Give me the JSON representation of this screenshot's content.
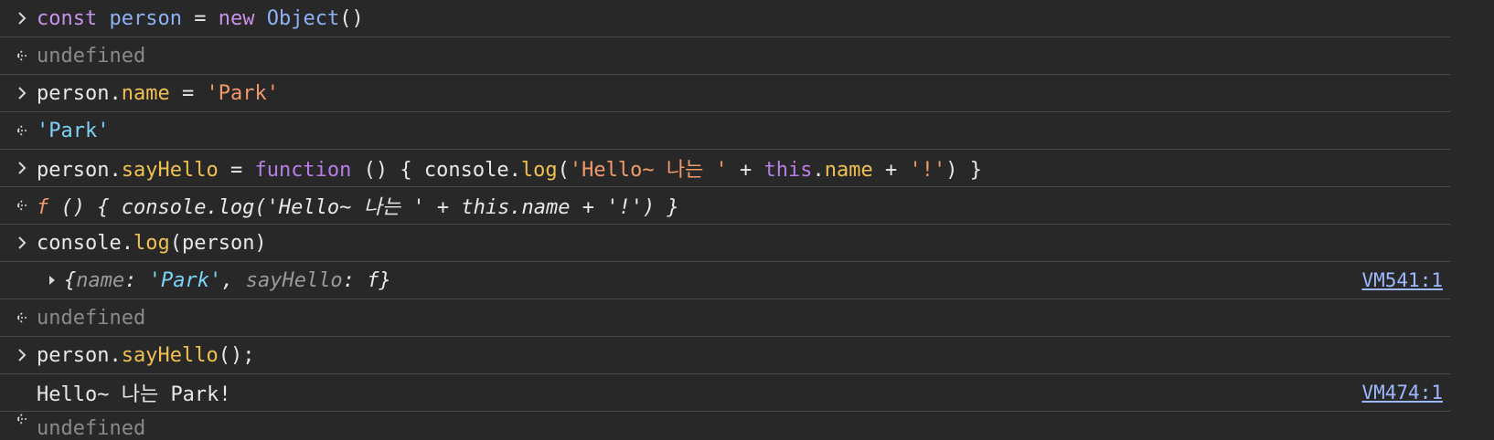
{
  "colors": {
    "background": "#282828",
    "separator": "#4a4a4a",
    "keyword": "#c792ea",
    "variable": "#8fb1f5",
    "property": "#f0c050",
    "string": "#f19a6a",
    "result_string": "#7dd3f7",
    "muted": "#8a8a8a",
    "link": "#9db8ff"
  },
  "icons": {
    "input": "chevron-right-icon",
    "result": "return-arrow-icon",
    "expand": "triangle-right-icon"
  },
  "rows": [
    {
      "kind": "input",
      "tokens": {
        "t1": "const",
        "t2": " ",
        "t3": "person",
        "t4": " = ",
        "t5": "new",
        "t6": " ",
        "t7": "Object",
        "t8": "()"
      }
    },
    {
      "kind": "result",
      "text": "undefined"
    },
    {
      "kind": "input",
      "tokens": {
        "t1": "person",
        "t2": ".",
        "t3": "name",
        "t4": " = ",
        "t5": "'Park'"
      }
    },
    {
      "kind": "result",
      "text": "'Park'"
    },
    {
      "kind": "input",
      "tokens": {
        "t1": "person",
        "t2": ".",
        "t3": "sayHello",
        "t4": " = ",
        "t5": "function",
        "t6": " () { ",
        "t7": "console",
        "t8": ".",
        "t9": "log",
        "t10": "(",
        "t11": "'Hello~ 나는 '",
        "t12": " + ",
        "t13": "this",
        "t14": ".",
        "t15": "name",
        "t16": " + ",
        "t17": "'!'",
        "t18": ") }"
      }
    },
    {
      "kind": "result",
      "tokens": {
        "t1": "f",
        "t2": " () { console.log('Hello~ 나는 ' + this.name + '!') }"
      }
    },
    {
      "kind": "input",
      "tokens": {
        "t1": "console",
        "t2": ".",
        "t3": "log",
        "t4": "(person)"
      }
    },
    {
      "kind": "log",
      "tokens": {
        "t1": "{",
        "t2": "name",
        "t3": ": ",
        "t4": "'Park'",
        "t5": ", ",
        "t6": "sayHello",
        "t7": ": ",
        "t8": "f",
        "t9": "}"
      },
      "source": "VM541:1"
    },
    {
      "kind": "result",
      "text": "undefined"
    },
    {
      "kind": "input",
      "tokens": {
        "t1": "person",
        "t2": ".",
        "t3": "sayHello",
        "t4": "();"
      }
    },
    {
      "kind": "log",
      "text": "Hello~ 나는 Park!",
      "source": "VM474:1"
    },
    {
      "kind": "result",
      "text": "undefined"
    }
  ]
}
